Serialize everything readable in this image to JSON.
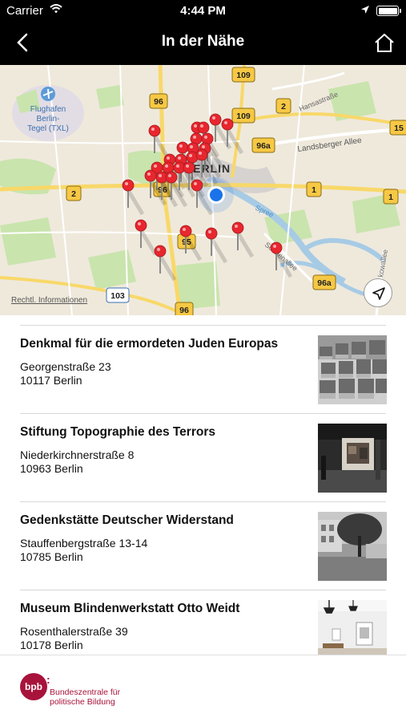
{
  "status_bar": {
    "carrier": "Carrier",
    "time": "4:44 PM"
  },
  "header": {
    "title": "In der Nähe",
    "back_icon": "chevron-left-icon",
    "home_icon": "home-icon"
  },
  "map": {
    "city_label": "BERLIN",
    "airport_label": [
      "Flughafen",
      "Berlin-",
      "Tegel (TXL)"
    ],
    "street_labels": [
      "Hansastraße",
      "Landsberger Allee",
      "Spree",
      "Sonnenallee",
      "kowallee"
    ],
    "road_badges": [
      "109",
      "96",
      "2",
      "109",
      "96a",
      "15",
      "2",
      "1",
      "1",
      "96",
      "95",
      "103",
      "96",
      "96a"
    ],
    "legal_link": "Rechtl. Informationen",
    "compass_icon": "location-arrow-icon",
    "pin_color": "#e8262e",
    "user_dot_color": "#1a73e8"
  },
  "places": [
    {
      "name": "Denkmal für die ermordeten Juden Europas",
      "street": "Georgenstraße 23",
      "city": "10117 Berlin"
    },
    {
      "name": "Stiftung Topographie des Terrors",
      "street": "Niederkirchnerstraße 8",
      "city": "10963 Berlin"
    },
    {
      "name": "Gedenkstätte Deutscher Widerstand",
      "street": "Stauffenbergstraße 13-14",
      "city": "10785 Berlin"
    },
    {
      "name": "Museum Blindenwerkstatt Otto Weidt",
      "street": "Rosenthalerstraße 39",
      "city": "10178 Berlin"
    }
  ],
  "footer": {
    "logo_abbr": "bpb",
    "logo_line1": "Bundeszentrale für",
    "logo_line2": "politische Bildung",
    "brand_color": "#a8133b"
  }
}
